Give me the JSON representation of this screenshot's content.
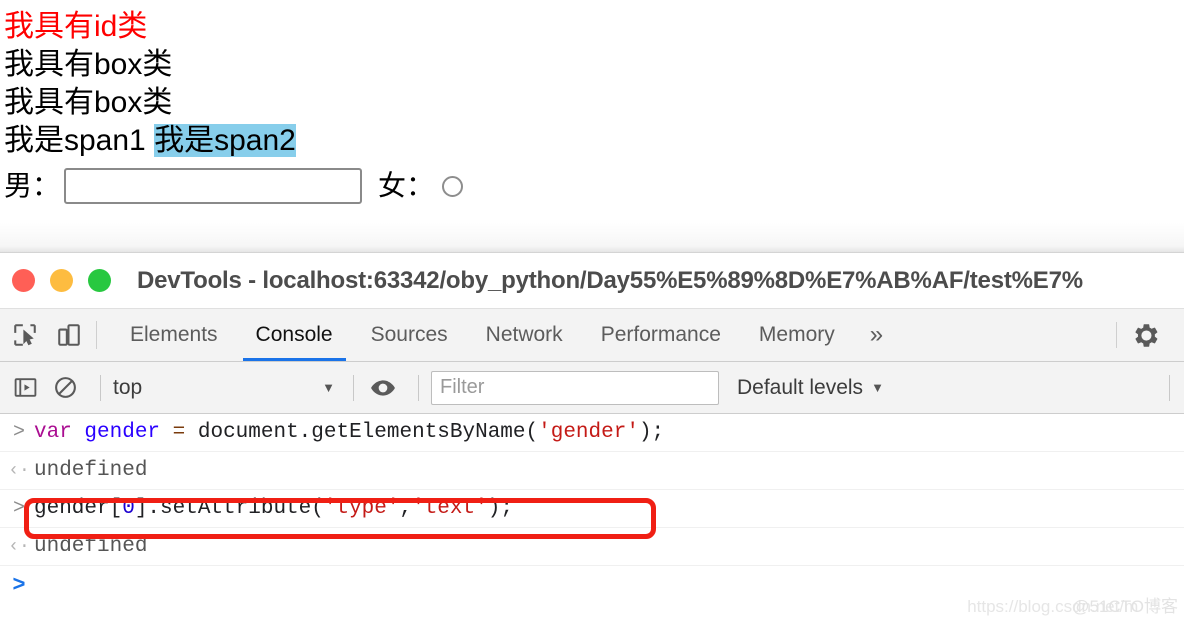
{
  "page": {
    "lines": [
      {
        "text": "我具有id类",
        "color": "#ff0000"
      },
      {
        "text": "我具有box类",
        "color": "#000000"
      },
      {
        "text": "我具有box类",
        "color": "#000000"
      },
      {
        "span1": "我是span1",
        "span2": "我是span2",
        "highlight_color": "#87ceeb"
      }
    ],
    "form": {
      "male_label": "男：",
      "male_input_value": "",
      "male_input_placeholder": "",
      "female_label": "女：",
      "female_control": "radio"
    }
  },
  "devtools": {
    "window_title": "DevTools - localhost:63342/oby_python/Day55%E5%89%8D%E7%AB%AF/test%E7%",
    "traffic_lights": [
      {
        "name": "close",
        "color": "#ff5f56"
      },
      {
        "name": "minimize",
        "color": "#fdbc40"
      },
      {
        "name": "maximize",
        "color": "#28c840"
      }
    ],
    "tabs": [
      {
        "label": "Elements",
        "active": false
      },
      {
        "label": "Console",
        "active": true
      },
      {
        "label": "Sources",
        "active": false
      },
      {
        "label": "Network",
        "active": false
      },
      {
        "label": "Performance",
        "active": false
      },
      {
        "label": "Memory",
        "active": false
      }
    ],
    "more_tabs_label": "»",
    "active_tab_underline_color": "#1a73e8",
    "toolbar": {
      "context_value": "top",
      "caret": "▼",
      "filter_placeholder": "Filter",
      "filter_value": "",
      "levels_label": "Default levels",
      "levels_caret": "▼"
    },
    "console_rows": [
      {
        "kind": "input",
        "arrow": ">",
        "tokens": [
          {
            "t": "var ",
            "c": "keyword"
          },
          {
            "t": "gender ",
            "c": "variable"
          },
          {
            "t": "= ",
            "c": "operator"
          },
          {
            "t": "document.getElementsByName(",
            "c": "plain"
          },
          {
            "t": "'gender'",
            "c": "string"
          },
          {
            "t": ");",
            "c": "plain"
          }
        ]
      },
      {
        "kind": "output",
        "arrow": "‹·",
        "text": "undefined"
      },
      {
        "kind": "input",
        "arrow": ">",
        "annotated": true,
        "tokens": [
          {
            "t": "gender[",
            "c": "plain"
          },
          {
            "t": "0",
            "c": "number"
          },
          {
            "t": "].setAttribute(",
            "c": "plain"
          },
          {
            "t": "'type'",
            "c": "string"
          },
          {
            "t": ",",
            "c": "plain"
          },
          {
            "t": "'text'",
            "c": "string"
          },
          {
            "t": ");",
            "c": "plain"
          }
        ]
      },
      {
        "kind": "output",
        "arrow": "‹·",
        "text": "undefined"
      },
      {
        "kind": "prompt",
        "arrow": ">",
        "text": ""
      }
    ],
    "annotation_color": "#f01f14"
  },
  "watermark": {
    "url": "https://blog.csdn.net/m",
    "brand": "@51CTO博客"
  }
}
